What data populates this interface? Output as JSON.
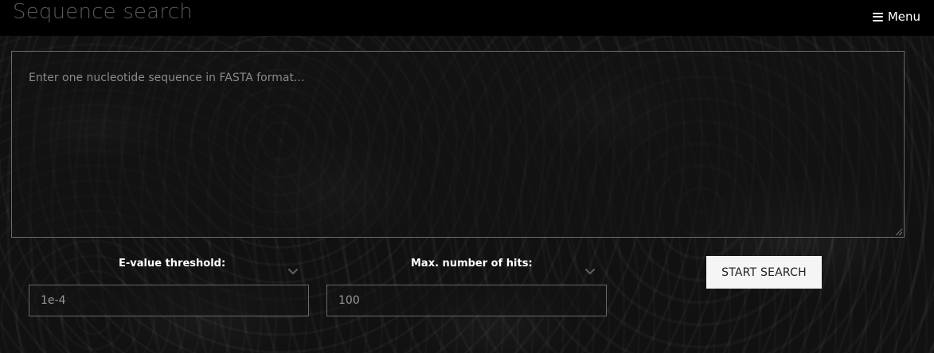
{
  "header": {
    "title": "Sequence search",
    "menu_label": "Menu",
    "menu_icon": "hamburger-icon"
  },
  "sequence": {
    "placeholder": "Enter one nucleotide sequence in FASTA format...",
    "value": ""
  },
  "params": {
    "evalue": {
      "label": "E-value threshold:",
      "value": "1e-4",
      "icon": "chevron-down-icon"
    },
    "max_hits": {
      "label": "Max. number of hits:",
      "value": "100",
      "icon": "chevron-down-icon"
    }
  },
  "actions": {
    "start_label": "START SEARCH"
  },
  "colors": {
    "topbar": "#000000",
    "title": "#5a5a5a",
    "button_bg": "#f5f5f5",
    "border": "#6a6a6a"
  }
}
